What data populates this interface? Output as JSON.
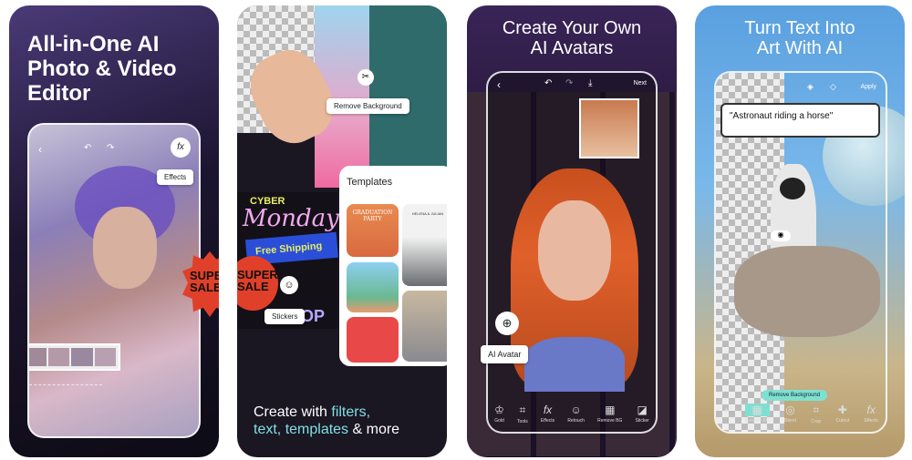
{
  "panel1": {
    "title_lines": [
      "All-in-One AI",
      "Photo & Video",
      "Editor"
    ],
    "effects_tag": "Effects",
    "fx_icon": "fx",
    "sale_badge": [
      "SUPER",
      "SALE"
    ]
  },
  "panel2": {
    "remove_bg_tag": "Remove Background",
    "templates_title": "Templates",
    "template_cards": [
      "GRADUATION PARTY",
      "HELENA & JULIAN"
    ],
    "stickers_tag": "Stickers",
    "collage_text": [
      "CYBER",
      "Monday",
      "Free Shipping",
      "SUPER SALE",
      "SHOP"
    ],
    "caption": {
      "a": "Create with ",
      "b": "filters,",
      "c": "text, ",
      "d": "templates",
      "e": " & more"
    },
    "accent": "#7fe0e6"
  },
  "panel3": {
    "title_lines": [
      "Create Your Own",
      "AI Avatars"
    ],
    "next": "Next",
    "ai_avatar_tag": "AI Avatar",
    "toolbar": [
      "Gold",
      "Tools",
      "Effects",
      "Retouch",
      "Remove BG",
      "Sticker"
    ]
  },
  "panel4": {
    "title_lines": [
      "Turn Text Into",
      "Art With AI"
    ],
    "apply": "Apply",
    "prompt": "\"Astronaut riding a horse\"",
    "remove_bg_button": "Remove Background",
    "toolbar": [
      "Remove BG",
      "Blend",
      "Crop",
      "Cutout",
      "Effects"
    ],
    "accent": "#7fe0d0"
  }
}
